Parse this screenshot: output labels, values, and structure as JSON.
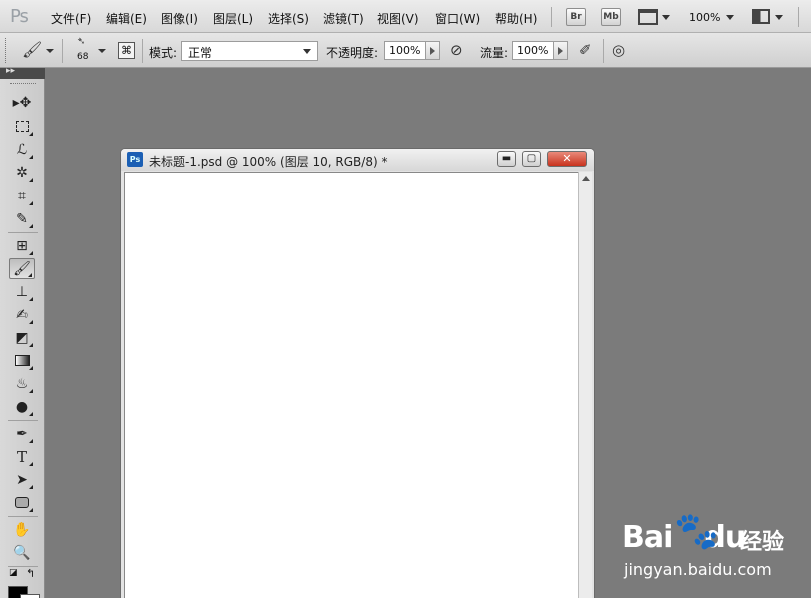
{
  "app": {
    "logo": "Ps"
  },
  "menu": [
    "文件(F)",
    "编辑(E)",
    "图像(I)",
    "图层(L)",
    "选择(S)",
    "滤镜(T)",
    "视图(V)",
    "窗口(W)",
    "帮助(H)"
  ],
  "menu_buttons": {
    "bridge": "Br",
    "mini_bridge": "Mb"
  },
  "zoom": "100%",
  "options": {
    "brush_size": "68",
    "mode_label": "模式:",
    "mode_value": "正常",
    "opacity_label": "不透明度:",
    "opacity_value": "100%",
    "flow_label": "流量:",
    "flow_value": "100%"
  },
  "document": {
    "icon": "Ps",
    "title": "未标题-1.psd @ 100% (图层 10, RGB/8) *",
    "minimize": "▬",
    "maximize": "▢",
    "close": "✕"
  },
  "tools": [
    "move-icon",
    "marquee-icon",
    "lasso-icon",
    "magic-wand-icon",
    "crop-icon",
    "eyedropper-icon",
    "healing-brush-icon",
    "brush-icon",
    "clone-stamp-icon",
    "history-brush-icon",
    "eraser-icon",
    "gradient-icon",
    "blur-icon",
    "dodge-icon",
    "pen-icon",
    "type-icon",
    "path-selection-icon",
    "shape-icon",
    "hand-icon",
    "zoom-icon"
  ],
  "watermark": {
    "brand": "Bai",
    "brand2": "du",
    "cn": "经验",
    "url": "jingyan.baidu.com"
  },
  "colors": {
    "canvas": "#ffffff",
    "workspace": "#7b7b7b",
    "close": "#c8321d"
  }
}
